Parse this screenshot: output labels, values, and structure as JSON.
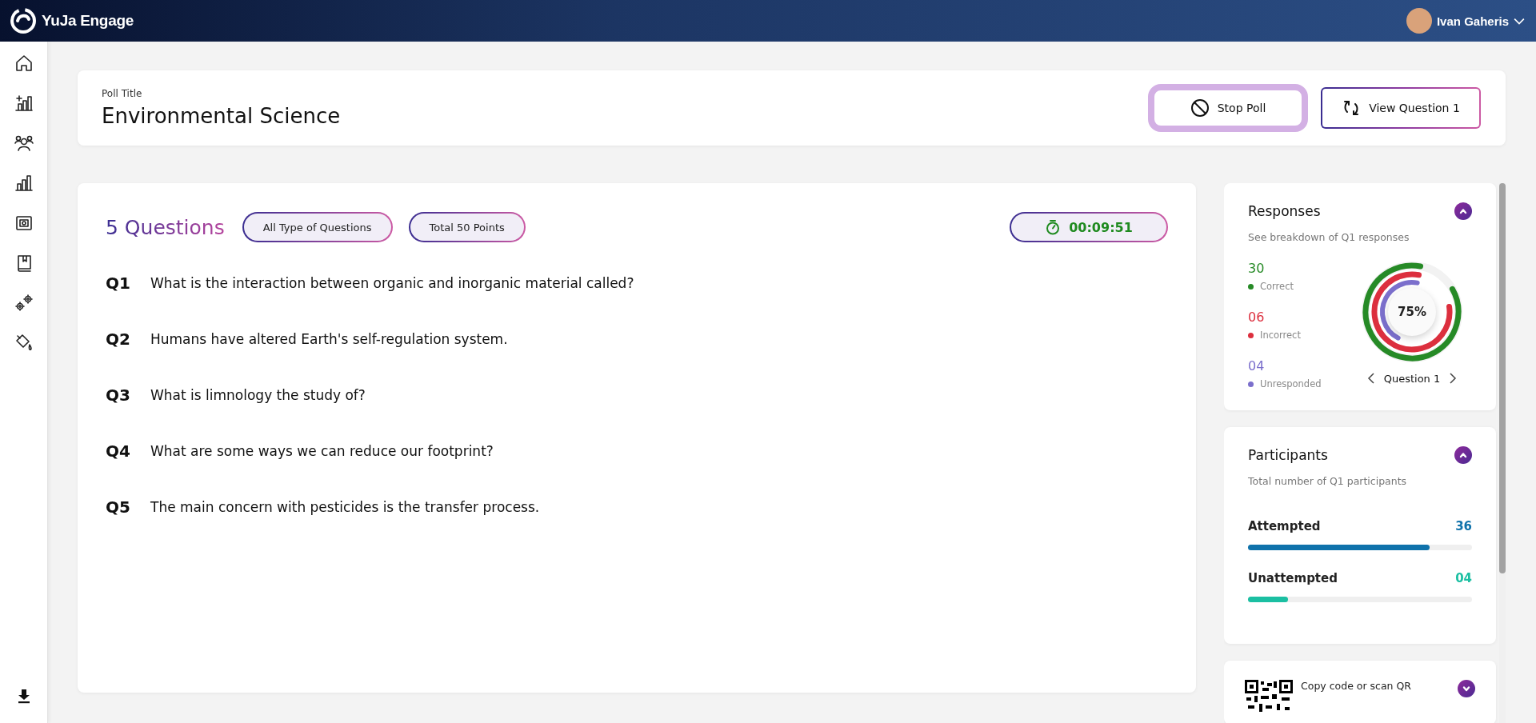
{
  "topbar": {
    "logo_text": "YuJa Engage",
    "user_name": "Ivan Gaheris"
  },
  "header": {
    "label": "Poll Title",
    "title": "Environmental Science",
    "buttons": [
      {
        "label": "Stop Poll",
        "kind": "stop"
      },
      {
        "label": "View Question 1",
        "kind": "view"
      }
    ]
  },
  "questions": {
    "heading": "5 Questions",
    "pills": [
      "All Type of Questions",
      "Total 50 Points"
    ],
    "timer": "00:09:51",
    "items": [
      {
        "number": "Q1",
        "text": "What is the interaction between organic and inorganic material called?"
      },
      {
        "number": "Q2",
        "text": "Humans have altered Earth's self-regulation system."
      },
      {
        "number": "Q3",
        "text": "What is limnology the study of?"
      },
      {
        "number": "Q4",
        "text": "What are some ways we can reduce our footprint?"
      },
      {
        "number": "Q5",
        "text": "The main concern with pesticides is the transfer process."
      }
    ]
  },
  "responses": {
    "title": "Responses",
    "subtitle": "See breakdown of Q1 responses",
    "percent": "75%",
    "nav_label": "Question 1",
    "items": [
      {
        "count": "30",
        "label": "Correct",
        "color": "#268a26"
      },
      {
        "count": "06",
        "label": "Incorrect",
        "color": "#dc2f3e"
      },
      {
        "count": "04",
        "label": "Unresponded",
        "color": "#7b6fcc"
      }
    ],
    "rings": [
      {
        "level": 0.86
      },
      {
        "level": 0.8
      },
      {
        "level": 0.45
      }
    ]
  },
  "participants": {
    "title": "Participants",
    "subtitle": "Total number of Q1 participants",
    "items": [
      {
        "label": "Attempted",
        "count": "36",
        "color": "#0f72ab",
        "level": 0.81
      },
      {
        "label": "Unattempted",
        "count": "04",
        "color": "#1bbfa2",
        "level": 0.18
      }
    ]
  },
  "qr_card": {
    "text": "Copy code or scan QR"
  }
}
